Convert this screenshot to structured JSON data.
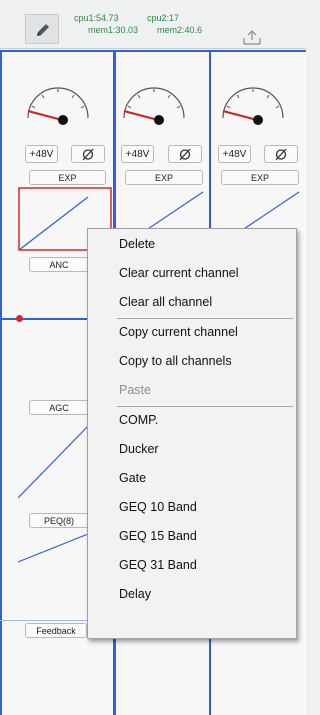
{
  "status": {
    "cpu1": "cpu1:54.73",
    "cpu2": "cpu2:17",
    "mem1": "mem1:30.03",
    "mem2": "mem2:40.6"
  },
  "icons": {
    "edit": "pencil-icon",
    "upload": "upload-icon",
    "phase": "phase-invert-icon"
  },
  "channels": [
    {
      "phantom": "+48V",
      "exp": "EXP",
      "anc": "ANC",
      "agc": "AGC",
      "peq": "PEQ(8)",
      "feedback": "Feedback"
    },
    {
      "phantom": "+48V",
      "exp": "EXP"
    },
    {
      "phantom": "+48V",
      "exp": "EXP"
    }
  ],
  "context_menu": {
    "items": [
      {
        "label": "Delete",
        "enabled": true
      },
      {
        "label": "Clear current channel",
        "enabled": true
      },
      {
        "label": "Clear all channel",
        "enabled": true
      },
      {
        "label": "Copy current channel",
        "enabled": true
      },
      {
        "label": "Copy to all channels",
        "enabled": true
      },
      {
        "label": "Paste",
        "enabled": false
      },
      {
        "label": "COMP.",
        "enabled": true
      },
      {
        "label": "Ducker",
        "enabled": true
      },
      {
        "label": "Gate",
        "enabled": true
      },
      {
        "label": "GEQ 10 Band",
        "enabled": true
      },
      {
        "label": "GEQ 15 Band",
        "enabled": true
      },
      {
        "label": "GEQ 31 Band",
        "enabled": true
      },
      {
        "label": "Delay",
        "enabled": true
      }
    ]
  },
  "colors": {
    "accent_blue": "#2e62d6",
    "selection_red": "#e02424",
    "status_green": "#2e8b3d",
    "needle_red": "#d42020"
  }
}
